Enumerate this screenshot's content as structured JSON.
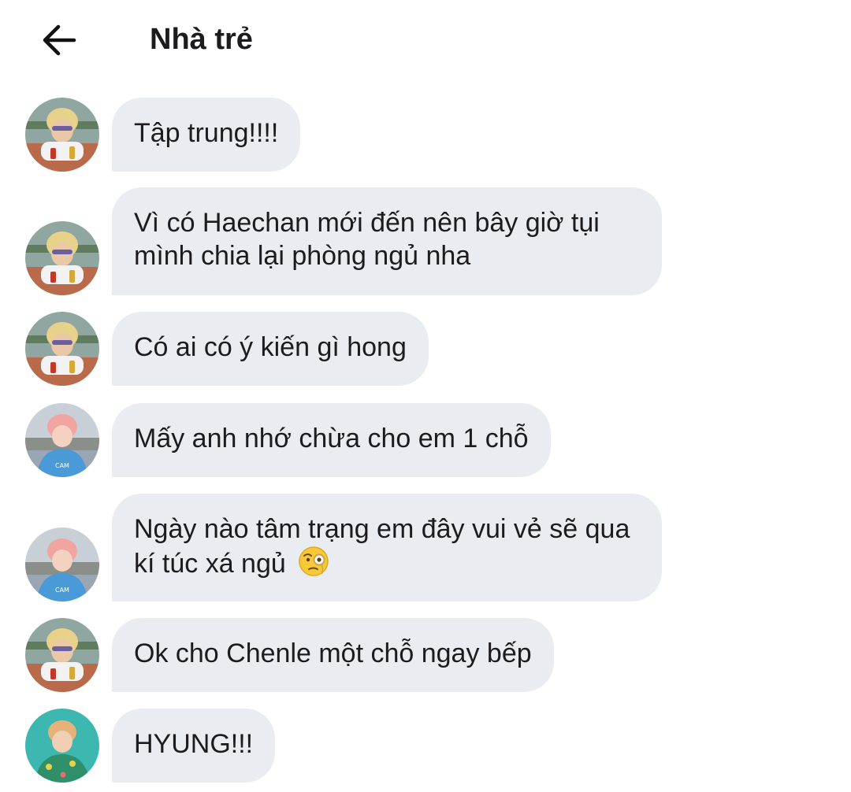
{
  "header": {
    "title": "Nhà trẻ"
  },
  "messages": [
    {
      "text": "Tập trung!!!!",
      "sender_icon": "avatar-blond-sunglasses",
      "reaction_emoji": ""
    },
    {
      "text": "Vì có Haechan mới đến nên bây giờ tụi mình chia lại phòng ngủ nha",
      "sender_icon": "avatar-blond-sunglasses",
      "reaction_emoji": ""
    },
    {
      "text": "Có ai có ý kiến gì hong",
      "sender_icon": "avatar-blond-sunglasses",
      "reaction_emoji": ""
    },
    {
      "text": "Mấy anh nhớ chừa cho em 1 chỗ",
      "sender_icon": "avatar-pink-hair",
      "reaction_emoji": ""
    },
    {
      "text": "Ngày nào tâm trạng em đây vui vẻ sẽ qua kí túc xá ngủ",
      "sender_icon": "avatar-pink-hair",
      "reaction_emoji": "face-with-monocle"
    },
    {
      "text": "Ok cho Chenle một chỗ ngay bếp",
      "sender_icon": "avatar-blond-sunglasses",
      "reaction_emoji": ""
    },
    {
      "text": "HYUNG!!!",
      "sender_icon": "avatar-teal-background",
      "reaction_emoji": ""
    }
  ],
  "colors": {
    "bubble_bg": "#e9edf2",
    "text": "#1c1c1e",
    "background": "#ffffff"
  }
}
